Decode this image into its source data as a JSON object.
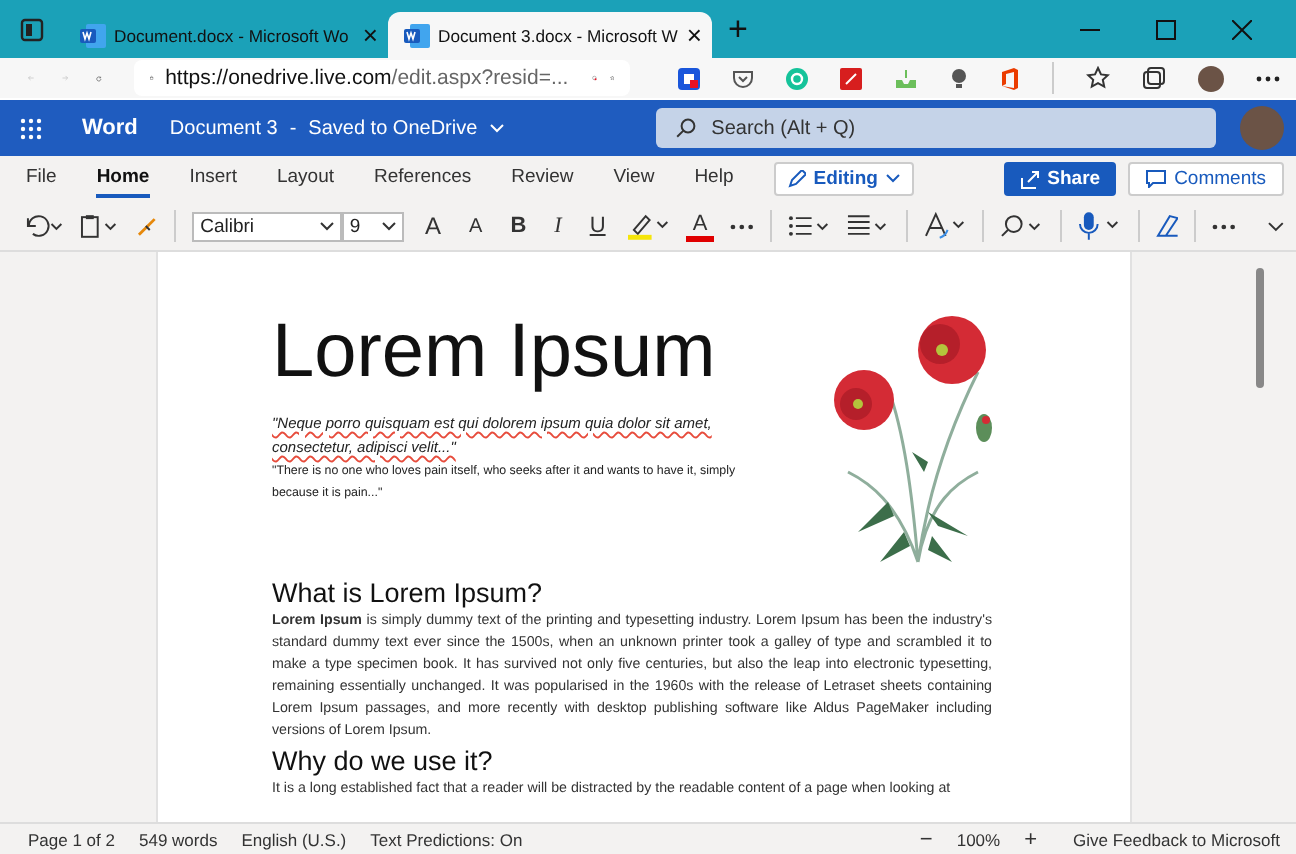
{
  "browser": {
    "tabs": [
      {
        "title": "Document.docx - Microsoft Wo",
        "selected": false
      },
      {
        "title": "Document 3.docx - Microsoft W",
        "selected": true
      }
    ],
    "close_glyph": "×",
    "new_tab": "+",
    "url_host": "https://onedrive.live.com",
    "url_path": "/edit.aspx?resid=..."
  },
  "header": {
    "app_name": "Word",
    "doc_title": "Document 3",
    "separator": "-",
    "save_status": "Saved to OneDrive",
    "search_placeholder": "Search (Alt + Q)"
  },
  "ribbon": {
    "tabs": [
      {
        "label": "File",
        "selected": false
      },
      {
        "label": "Home",
        "selected": true
      },
      {
        "label": "Insert",
        "selected": false
      },
      {
        "label": "Layout",
        "selected": false
      },
      {
        "label": "References",
        "selected": false
      },
      {
        "label": "Review",
        "selected": false
      },
      {
        "label": "View",
        "selected": false
      },
      {
        "label": "Help",
        "selected": false
      }
    ],
    "mode": "Editing",
    "share": "Share",
    "comments": "Comments"
  },
  "toolbar": {
    "font": "Calibri",
    "size": "9",
    "grow": "A",
    "shrink": "A",
    "bold": "B",
    "italic": "I",
    "underline": "U",
    "font_color_glyph": "A"
  },
  "document": {
    "title": "Lorem Ipsum",
    "quote_latin": "\"Neque porro quisquam est qui dolorem ipsum quia dolor sit amet, consectetur, adipisci velit...\"",
    "quote_english": "\"There is no one who loves pain itself, who seeks after it and wants to have it, simply because it is pain...\"",
    "sections": [
      {
        "heading": "What is Lorem Ipsum?",
        "paragraph": "**Lorem Ipsum** is simply dummy text of the printing and typesetting industry. Lorem Ipsum has been the industry's standard dummy text ever since the 1500s, when an unknown printer took a galley of type and scrambled it to make a type specimen book. It has survived not only five centuries, but also the leap into electronic typesetting, remaining essentially unchanged. It was popularised in the 1960s with the release of Letraset sheets containing Lorem Ipsum passages, and more recently with desktop publishing software like Aldus PageMaker including versions of Lorem Ipsum."
      },
      {
        "heading": "Why do we use it?",
        "paragraph": "It is a long established fact that a reader will be distracted by the readable content of a page when looking at"
      }
    ]
  },
  "status_bar": {
    "page": "Page 1 of 2",
    "words": "549 words",
    "language": "English (U.S.)",
    "predictions": "Text Predictions: On",
    "zoom_out": "−",
    "zoom": "100%",
    "zoom_in": "+",
    "feedback": "Give Feedback to Microsoft"
  }
}
